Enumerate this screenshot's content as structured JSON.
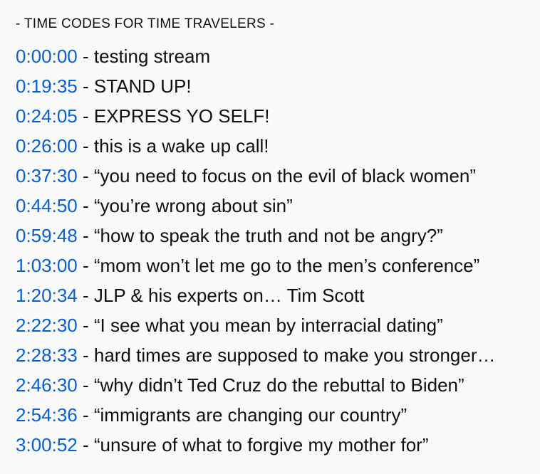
{
  "description": {
    "heading": "- TIME CODES FOR TIME TRAVELERS -",
    "separator": " - ",
    "entries": [
      {
        "time": "0:00:00",
        "text": "testing stream"
      },
      {
        "time": "0:19:35",
        "text": "STAND UP!"
      },
      {
        "time": "0:24:05",
        "text": "EXPRESS YO SELF!"
      },
      {
        "time": "0:26:00",
        "text": "this is a wake up call!"
      },
      {
        "time": "0:37:30",
        "text": "“you need to focus on the evil of black women”"
      },
      {
        "time": "0:44:50",
        "text": "“you’re wrong about sin”"
      },
      {
        "time": "0:59:48",
        "text": "“how to speak the truth and not be angry?”"
      },
      {
        "time": "1:03:00",
        "text": "“mom won’t let me go to the men’s conference”"
      },
      {
        "time": "1:20:34",
        "text": "JLP & his experts on… Tim Scott"
      },
      {
        "time": "2:22:30",
        "text": "“I see what you mean by interracial dating”"
      },
      {
        "time": "2:28:33",
        "text": "hard times are supposed to make you stronger…"
      },
      {
        "time": "2:46:30",
        "text": "“why didn’t Ted Cruz do the rebuttal to Biden”"
      },
      {
        "time": "2:54:36",
        "text": "“immigrants are changing our country”"
      },
      {
        "time": "3:00:52",
        "text": "“unsure of what to forgive my mother for”"
      }
    ]
  }
}
